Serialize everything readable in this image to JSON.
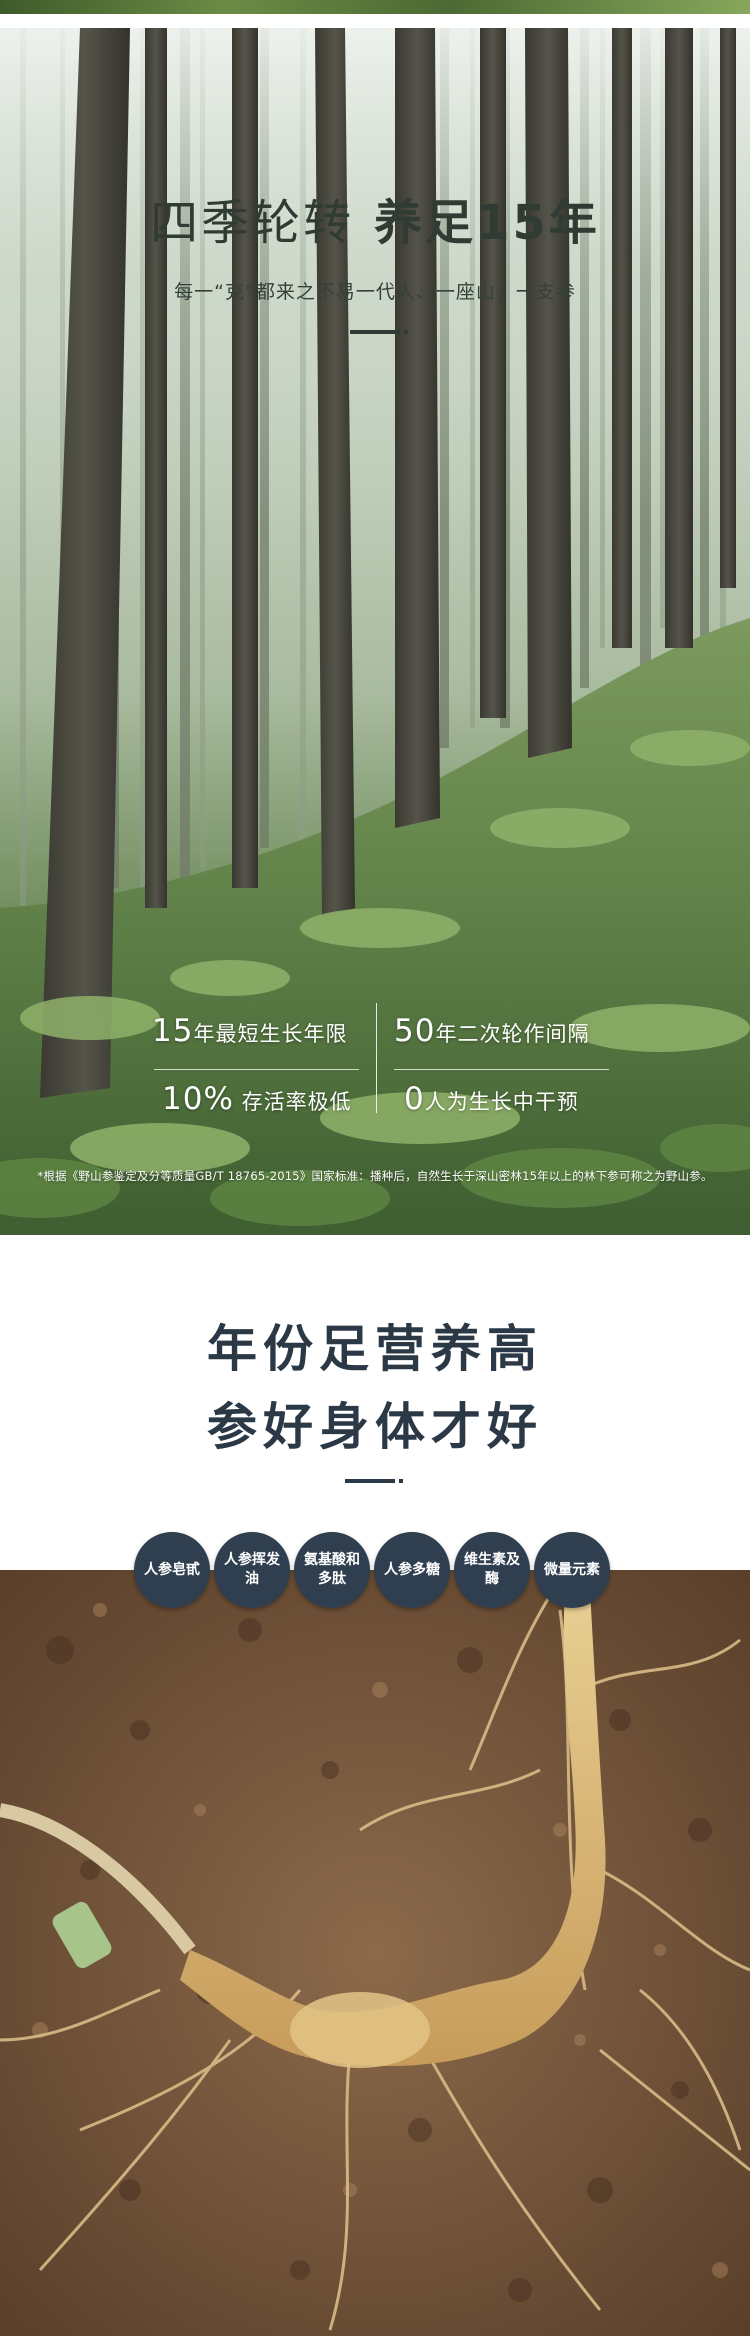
{
  "forest": {
    "title_part1": "四季轮转",
    "title_part2": "养足15年",
    "subtitle": "每一“克”都来之不易一代人、一座山、一支参",
    "stats": [
      {
        "number": "15",
        "text": "年最短生长年限"
      },
      {
        "number": "50",
        "text": "年二次轮作间隔"
      },
      {
        "number": "10%",
        "text": " 存活率极低"
      },
      {
        "number": "0",
        "text": "人为生长中干预"
      }
    ],
    "footnote": "*根据《野山参鉴定及分等质量GB/T 18765-2015》国家标准：播种后，自然生长于深山密林15年以上的林下参可称之为野山参。"
  },
  "nutrition": {
    "title_line1": "年份足营养高",
    "title_line2": "参好身体才好",
    "badges": [
      "人参皂甙",
      "人参挥发油",
      "氨基酸和多肽",
      "人参多糖",
      "维生素及酶",
      "微量元素"
    ]
  },
  "colors": {
    "navy": "#2b3845",
    "badge_bg": "#2f3f4f",
    "forest_green": "#4d6f3e"
  }
}
